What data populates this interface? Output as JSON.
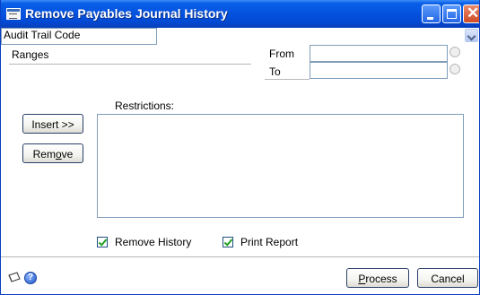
{
  "window": {
    "title": "Remove Payables Journal History"
  },
  "ranges": {
    "label": "Ranges",
    "selected": "Audit Trail Code",
    "from_label": "From",
    "to_label": "To",
    "from_value": "",
    "to_value": ""
  },
  "restrictions": {
    "label": "Restrictions:",
    "items": []
  },
  "buttons": {
    "insert": "Insert >>",
    "remove_pre": "Rem",
    "remove_mn": "o",
    "remove_post": "ve",
    "process_mn": "P",
    "process_post": "rocess",
    "cancel": "Cancel"
  },
  "options": {
    "remove_history": {
      "label": "Remove History",
      "checked": true
    },
    "print_report": {
      "label": "Print Report",
      "checked": true
    }
  },
  "icons": {
    "title": "window-icon",
    "note": "note-icon",
    "help": "help-icon",
    "lookup": "lookup-icon",
    "dropdown": "chevron-down-icon"
  },
  "colors": {
    "titlebar": "#0554e0",
    "window_border": "#0a3fc4",
    "checkmark": "#21a121",
    "field_border": "#7f9db9"
  }
}
